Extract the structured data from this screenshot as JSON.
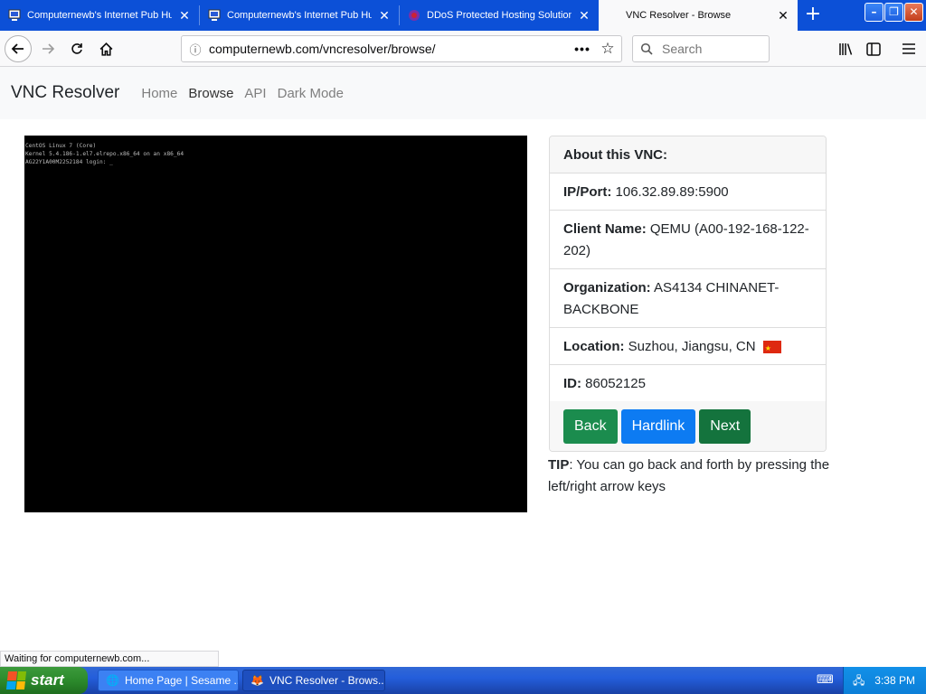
{
  "browser": {
    "tabs": [
      {
        "title": "Computernewb's Internet Pub Hu",
        "favicon": "vnc-icon",
        "active": false
      },
      {
        "title": "Computernewb's Internet Pub Hu",
        "favicon": "vnc-icon",
        "active": false
      },
      {
        "title": "DDoS Protected Hosting Solutions",
        "favicon": "globe-icon",
        "active": false
      },
      {
        "title": "VNC Resolver - Browse",
        "favicon": "",
        "active": true
      }
    ],
    "url": "computernewb.com/vncresolver/browse/",
    "search_placeholder": "Search",
    "status_text": "Waiting for computernewb.com..."
  },
  "site": {
    "brand": "VNC Resolver",
    "nav": [
      "Home",
      "Browse",
      "API",
      "Dark Mode"
    ],
    "active_nav": "Browse"
  },
  "terminal": {
    "lines": [
      "CentOS Linux 7 (Core)",
      "Kernel 5.4.186-1.el7.elrepo.x86_64 on an x86_64",
      "",
      "AG22Y1A00M2252184 login: _"
    ]
  },
  "vnc_info": {
    "header": "About this VNC:",
    "ip_label": "IP/Port:",
    "ip_value": "106.32.89.89:5900",
    "client_label": "Client Name:",
    "client_value": "QEMU (A00-192-168-122-202)",
    "org_label": "Organization:",
    "org_value": "AS4134 CHINANET-BACKBONE",
    "location_label": "Location:",
    "location_value": "Suzhou, Jiangsu, CN",
    "location_flag": "cn-flag-icon",
    "id_label": "ID:",
    "id_value": "86052125"
  },
  "buttons": {
    "back": "Back",
    "hardlink": "Hardlink",
    "next": "Next"
  },
  "tip": {
    "label": "TIP",
    "text": ": You can go back and forth by pressing the left/right arrow keys"
  },
  "taskbar": {
    "start_label": "start",
    "items": [
      "Home Page | Sesame ...",
      "VNC Resolver - Brows..."
    ],
    "clock": "3:38 PM"
  },
  "colors": {
    "tab_strip": "#0c50d7",
    "btn_green": "#1b8c4e",
    "btn_blue": "#0d7bf2",
    "btn_dark_green": "#14733d"
  }
}
